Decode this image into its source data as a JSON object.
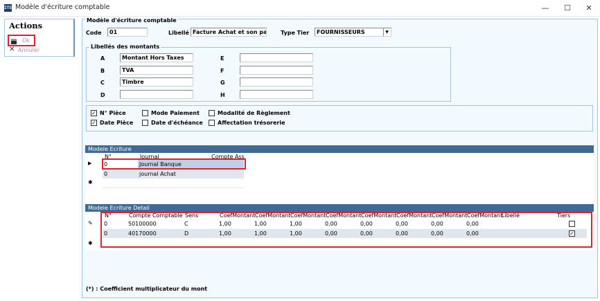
{
  "window": {
    "icon_text": "ITS",
    "title": "Modèle d'écriture comptable",
    "minimize": "—",
    "maximize": "☐",
    "close": "✕"
  },
  "sidebar": {
    "title": "Actions",
    "ok_label": "Ok",
    "cancel_label": "Annuler",
    "cancel_icon": "✕"
  },
  "form": {
    "group_title": "Modèle d'écriture comptable",
    "code_label": "Code",
    "code_value": "01",
    "libelle_label": "Libellé",
    "libelle_value": "Facture Achat et son pai",
    "type_tier_label": "Type Tier",
    "type_tier_value": "FOURNISSEURS",
    "amounts_group_title": "Libellés des montants",
    "amounts": [
      {
        "letter": "A",
        "value": "Montant Hors Taxes"
      },
      {
        "letter": "B",
        "value": "TVA"
      },
      {
        "letter": "C",
        "value": "Timbre"
      },
      {
        "letter": "D",
        "value": ""
      },
      {
        "letter": "E",
        "value": ""
      },
      {
        "letter": "F",
        "value": ""
      },
      {
        "letter": "G",
        "value": ""
      },
      {
        "letter": "H",
        "value": ""
      }
    ],
    "checkboxes": [
      {
        "label": "N° Pièce",
        "checked": true
      },
      {
        "label": "Date Pièce",
        "checked": true
      },
      {
        "label": "Mode Paiement",
        "checked": false
      },
      {
        "label": "Date d'échéance",
        "checked": false
      },
      {
        "label": "Modalité de Règlement",
        "checked": false
      },
      {
        "label": "Affectation trésorerie",
        "checked": false
      }
    ]
  },
  "grid1": {
    "title": "Modele Ecriture",
    "headers": [
      "N°",
      "Journal",
      "Compte Ass"
    ],
    "rows": [
      [
        "0",
        "Journal Banque",
        ""
      ],
      [
        "0",
        "journal Achat",
        ""
      ]
    ]
  },
  "grid2": {
    "title": "Modele Ecriture Detail",
    "headers": [
      "N°",
      "Compte Comptable",
      "Sens",
      "CoefMontant",
      "CoefMontant",
      "CoefMontant",
      "CoefMontant",
      "CoefMontant",
      "CoefMontant",
      "CoefMontant",
      "CoefMontant",
      "Libellé",
      "Tiers"
    ],
    "rows": [
      {
        "cells": [
          "0",
          "50100000",
          "C",
          "1,00",
          "1,00",
          "1,00",
          "0,00",
          "0,00",
          "0,00",
          "0,00",
          "0,00",
          ""
        ],
        "tiers": false
      },
      {
        "cells": [
          "0",
          "40170000",
          "D",
          "1,00",
          "1,00",
          "1,00",
          "0,00",
          "0,00",
          "0,00",
          "0,00",
          "0,00",
          ""
        ],
        "tiers": true
      }
    ]
  },
  "footnote": "(*) : Coefficient multiplicateur du mont"
}
